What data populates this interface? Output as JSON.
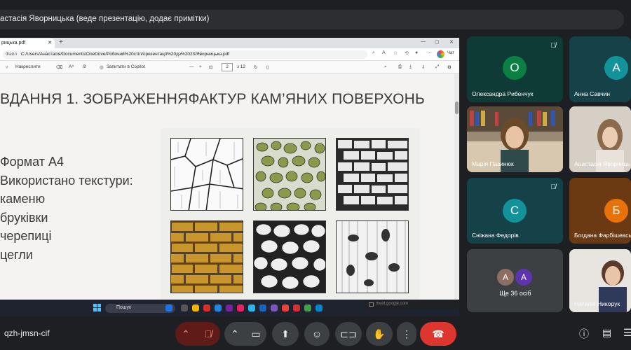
{
  "meeting": {
    "presenter_bar": "астасія Яворницька (веде презентацію, додає примітки)",
    "code": "qzh-jmsn-cif"
  },
  "browser": {
    "tab_title": "рицька.pdf",
    "url_label": "Файл",
    "url": "C:/Users/Анастасія/Documents/OneDrive/Робочий%20стіл/презентації%20дз%2023/Яворницька.pdf",
    "chat_label": "Чат"
  },
  "pdf_toolbar": {
    "draw": "Накреслити",
    "read_aloud": "Aᴀ",
    "ask_copilot": "Запитати в Copilot",
    "page": "2",
    "page_total": "з 12"
  },
  "slide": {
    "title": "ВДАННЯ 1. ЗОБРАЖЕННЯФАКТУР КАМ’ЯНИХ ПОВЕРХОНЬ",
    "bullets": [
      "Формат А4",
      "Використано текстури:",
      "каменю",
      "бруківки",
      "черепиці",
      "цегли"
    ]
  },
  "taskbar": {
    "search": "Пошук",
    "toast": "meet.google.com"
  },
  "participants": [
    {
      "name": "Олександра Рибенчук",
      "initial": "О",
      "color": "#0b8043",
      "muted": true
    },
    {
      "name": "Анна Савчин",
      "initial": "А",
      "color": "#12939a",
      "muted": false
    },
    {
      "name": "Марія Пазинюк",
      "muted": false
    },
    {
      "name": "Анастасія Яворниць",
      "muted": false
    },
    {
      "name": "Сніжана Федорів",
      "initial": "С",
      "color": "#12939a",
      "muted": true
    },
    {
      "name": "Богдана Фарбішевсь",
      "initial": "Б",
      "color": "#e8710a",
      "muted": false
    },
    {
      "name": "Наталія Никорук",
      "muted": false
    }
  ],
  "more": {
    "label": "Ще 36 осіб",
    "avatars": [
      {
        "initial": "А",
        "color": "#8d6e63"
      },
      {
        "initial": "А",
        "color": "#5e35b1"
      }
    ]
  },
  "colors": {
    "tile_green": "#0f3b36",
    "tile_teal": "#144248",
    "tile_orange": "#6b3a12",
    "tile_grey": "#3c4043",
    "hangup": "#dc362e"
  }
}
